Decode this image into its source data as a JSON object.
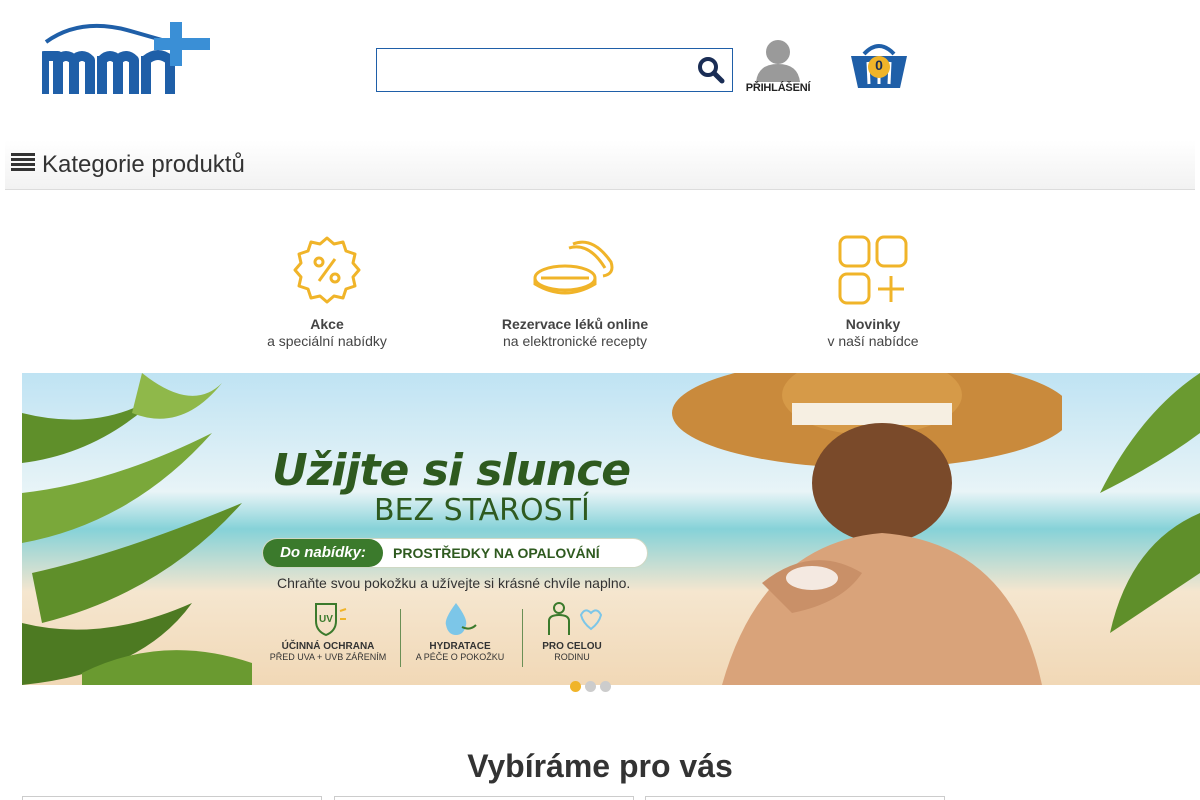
{
  "header": {
    "logo_text": "mmn+",
    "search": {
      "value": "",
      "placeholder": ""
    },
    "login_label": "PŘIHLÁŠENÍ",
    "cart_count": "0"
  },
  "category_bar": {
    "label": "Kategorie produktů"
  },
  "tiles": [
    {
      "title": "Akce",
      "subtitle": "a speciální nabídky",
      "icon": "percent-badge-icon"
    },
    {
      "title": "Rezervace léků online",
      "subtitle": "na elektronické recepty",
      "icon": "pills-icon"
    },
    {
      "title": "Novinky",
      "subtitle": "v naší nabídce",
      "icon": "grid-plus-icon"
    }
  ],
  "banner": {
    "headline": "Užijte si slunce",
    "subline": "BEZ STAROSTÍ",
    "pill_left": "Do nabídky:",
    "pill_right": "PROSTŘEDKY NA OPALOVÁNÍ",
    "note": "Chraňte svou pokožku a užívejte si krásné chvíle naplno.",
    "features": [
      {
        "title": "ÚČINNÁ OCHRANA",
        "sub": "PŘED UVA + UVB ZÁŘENÍM"
      },
      {
        "title": "HYDRATACE",
        "sub": "A PÉČE O POKOŽKU"
      },
      {
        "title": "PRO CELOU",
        "sub": "RODINU"
      }
    ]
  },
  "carousel": {
    "slides": 3,
    "active": 1
  },
  "section": {
    "title": "Vybíráme pro vás"
  },
  "colors": {
    "brand_blue": "#1f5fa8",
    "accent_orange": "#f0b429",
    "banner_green": "#2e5a1f"
  }
}
